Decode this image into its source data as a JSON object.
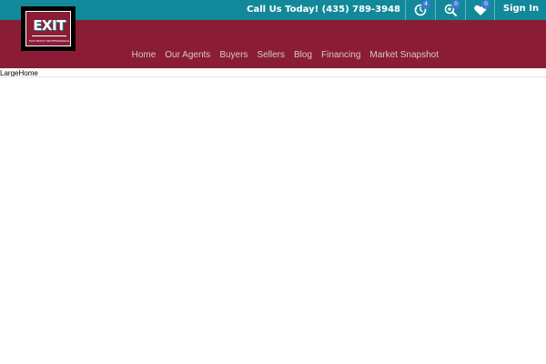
{
  "header": {
    "call_label": "Call Us Today! (435) 789-3948",
    "logo_text": "EXIT",
    "logo_subtext": "EXIT REALTY PROFESSIONALS",
    "tools": [
      {
        "name": "history",
        "icon": "history-icon",
        "badge": "4"
      },
      {
        "name": "saved-searches",
        "icon": "search-plus-icon",
        "badge": "0"
      },
      {
        "name": "favorites",
        "icon": "heart-icon",
        "badge": "0"
      }
    ],
    "signin_label": "Sign In"
  },
  "nav": {
    "items": [
      "Home",
      "Our Agents",
      "Buyers",
      "Sellers",
      "Blog",
      "Financing",
      "Market Snapshot"
    ]
  },
  "main": {
    "image_alt": "LargeHome"
  },
  "colors": {
    "topbar": "#12899a",
    "mainbar": "#8a1d35",
    "badge": "#3b7bd6"
  }
}
